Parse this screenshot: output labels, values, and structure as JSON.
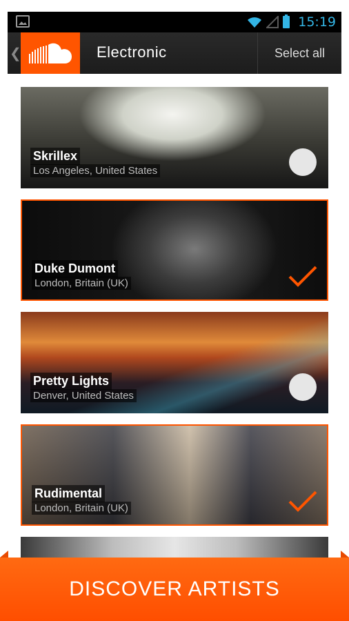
{
  "status_bar": {
    "time": "15:19",
    "icons": [
      "image-icon",
      "wifi-icon",
      "signal-icon",
      "battery-icon"
    ]
  },
  "action_bar": {
    "back_glyph": "❮",
    "title": "Electronic",
    "select_all_label": "Select all"
  },
  "artists": [
    {
      "name": "Skrillex",
      "location": "Los Angeles, United States",
      "selected": false
    },
    {
      "name": "Duke Dumont",
      "location": "London, Britain (UK)",
      "selected": true
    },
    {
      "name": "Pretty Lights",
      "location": "Denver, United States",
      "selected": false
    },
    {
      "name": "Rudimental",
      "location": "London, Britain (UK)",
      "selected": true
    }
  ],
  "discover_button_label": "DISCOVER ARTISTS",
  "colors": {
    "accent": "#ff5500",
    "status_blue": "#33b5e5"
  }
}
